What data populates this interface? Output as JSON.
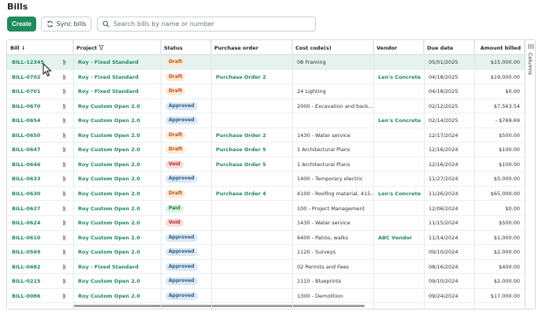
{
  "page": {
    "title": "Bills",
    "create_label": "Create",
    "sync_label": "Sync bills",
    "search_placeholder": "Search bills by name or number"
  },
  "columns": [
    "Bill",
    "Project",
    "Status",
    "Purchase order",
    "Cost code(s)",
    "Vendor",
    "Due date",
    "Amount billed"
  ],
  "side_panel_label": "Columns",
  "rows": [
    {
      "bill": "BILL-12345",
      "project": "Roy - Fixed Standard",
      "status": "Draft",
      "po": "",
      "cost": "08 Framing",
      "vendor": "",
      "due": "05/01/2025",
      "amount": "$15,000.00"
    },
    {
      "bill": "BILL-0702",
      "project": "Roy - Fixed Standard",
      "status": "Draft",
      "po": "Purchase Order 2",
      "cost": "",
      "vendor": "Len's Concrete",
      "due": "04/18/2025",
      "amount": "$19,000.00"
    },
    {
      "bill": "BILL-0701",
      "project": "Roy - Fixed Standard",
      "status": "Draft",
      "po": "",
      "cost": "24 Lighting",
      "vendor": "",
      "due": "04/18/2025",
      "amount": "$0.00"
    },
    {
      "bill": "BILL-0670",
      "project": "Roy Custom Open 2.0",
      "status": "Approved",
      "po": "",
      "cost": "2000 - Excavation and back...",
      "vendor": "",
      "due": "02/12/2025",
      "amount": "$7,563.54"
    },
    {
      "bill": "BILL-0654",
      "project": "Roy Custom Open 2.0",
      "status": "Approved",
      "po": "",
      "cost": "",
      "vendor": "Len's Concrete",
      "due": "02/14/2025",
      "amount": "- $769.69"
    },
    {
      "bill": "BILL-0650",
      "project": "Roy Custom Open 2.0",
      "status": "Draft",
      "po": "Purchase Order 2",
      "cost": "1430 - Water service",
      "vendor": "",
      "due": "12/17/2024",
      "amount": "$500.00"
    },
    {
      "bill": "BILL-0647",
      "project": "Roy Custom Open 2.0",
      "status": "Draft",
      "po": "Purchase Order 5",
      "cost": "1 Architectural Plans",
      "vendor": "",
      "due": "12/16/2024",
      "amount": "$100.00"
    },
    {
      "bill": "BILL-0646",
      "project": "Roy Custom Open 2.0",
      "status": "Void",
      "po": "Purchase Order 5",
      "cost": "1 Architectural Plans",
      "vendor": "",
      "due": "12/16/2024",
      "amount": "$100.00"
    },
    {
      "bill": "BILL-0633",
      "project": "Roy Custom Open 2.0",
      "status": "Approved",
      "po": "",
      "cost": "1400 - Temporary electric",
      "vendor": "",
      "due": "11/27/2024",
      "amount": "$5,000.00"
    },
    {
      "bill": "BILL-0630",
      "project": "Roy Custom Open 2.0",
      "status": "Draft",
      "po": "Purchase Order 4",
      "cost": "4100 - Roofing material, 415...",
      "vendor": "Len's Concrete",
      "due": "11/26/2024",
      "amount": "$65,000.00"
    },
    {
      "bill": "BILL-0627",
      "project": "Roy Custom Open 2.0",
      "status": "Paid",
      "po": "",
      "cost": "100 - Project Management",
      "vendor": "",
      "due": "12/06/2024",
      "amount": "$0.00"
    },
    {
      "bill": "BILL-0624",
      "project": "Roy Custom Open 2.0",
      "status": "Void",
      "po": "",
      "cost": "1430 - Water service",
      "vendor": "",
      "due": "11/15/2024",
      "amount": "$500.00"
    },
    {
      "bill": "BILL-0610",
      "project": "Roy Custom Open 2.0",
      "status": "Approved",
      "po": "",
      "cost": "6400 - Patios, walks",
      "vendor": "ABC Vendor",
      "due": "11/14/2024",
      "amount": "$1,000.00"
    },
    {
      "bill": "BILL-0569",
      "project": "Roy Custom Open 2.0",
      "status": "Approved",
      "po": "",
      "cost": "1120 - Surveys",
      "vendor": "",
      "due": "09/10/2024",
      "amount": "$2,000.00"
    },
    {
      "bill": "BILL-0482",
      "project": "Roy - Fixed Standard",
      "status": "Approved",
      "po": "",
      "cost": "02 Permits and Fees",
      "vendor": "",
      "due": "08/16/2024",
      "amount": "$400.00"
    },
    {
      "bill": "BILL-0215",
      "project": "Roy Custom Open 2.0",
      "status": "Approved",
      "po": "",
      "cost": "1110 - Blueprints",
      "vendor": "",
      "due": "09/10/2024",
      "amount": "$2,000.00"
    },
    {
      "bill": "BILL-0086",
      "project": "Roy Custom Open 2.0",
      "status": "Approved",
      "po": "",
      "cost": "1300 - Demolition",
      "vendor": "",
      "due": "09/24/2024",
      "amount": "$17,000.00"
    }
  ],
  "colors": {
    "accent": "#1f8a5e",
    "selected_row": "#e4f3ef",
    "draft": "#b5531d",
    "approved": "#2d5d86",
    "void": "#b42525",
    "paid": "#1f7a4a"
  }
}
